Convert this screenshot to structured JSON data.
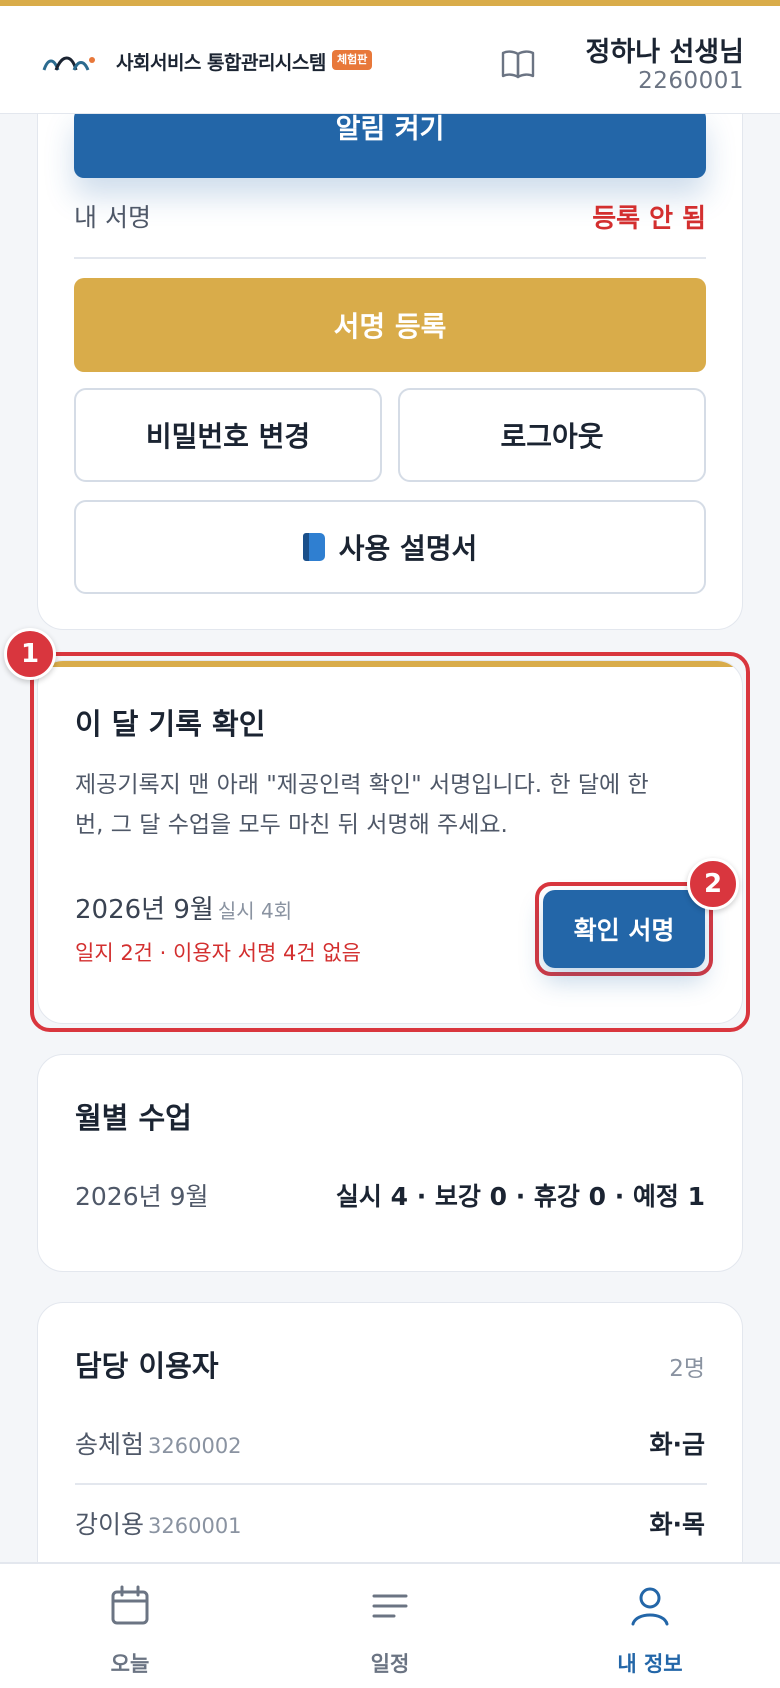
{
  "header": {
    "app_title": "사회서비스 통합관리시스템",
    "badge": "체험판",
    "user_name": "정하나 선생님",
    "user_id": "2260001"
  },
  "account": {
    "notify_button": "알림 켜기",
    "signature_label": "내 서명",
    "signature_status": "등록 안 됨",
    "register_signature_button": "서명 등록",
    "change_password_button": "비밀번호 변경",
    "logout_button": "로그아웃",
    "manual_button": "사용 설명서"
  },
  "monthly_sign": {
    "title": "이 달 기록 확인",
    "description": "제공기록지 맨 아래 \"제공인력 확인\" 서명입니다. 한 달에 한 번, 그 달 수업을 모두 마친 뒤 서명해 주세요.",
    "month": "2026년 9월",
    "count": "실시 4회",
    "warning": "일지 2건 · 이용자 서명 4건 없음",
    "confirm_button": "확인 서명"
  },
  "markers": [
    "1",
    "2"
  ],
  "monthly_classes": {
    "title": "월별 수업",
    "month": "2026년 9월",
    "summary": "실시 4 · 보강 0 · 휴강 0 · 예정 1"
  },
  "clients": {
    "title": "담당 이용자",
    "count": "2명",
    "items": [
      {
        "name": "송체험",
        "id": "3260002",
        "days": "화·금"
      },
      {
        "name": "강이용",
        "id": "3260001",
        "days": "화·목"
      }
    ]
  },
  "nav": {
    "items": [
      {
        "label": "오늘",
        "icon": "calendar-icon"
      },
      {
        "label": "일정",
        "icon": "list-icon"
      },
      {
        "label": "내 정보",
        "icon": "person-icon"
      }
    ],
    "active": "내 정보"
  },
  "colors": {
    "primary": "#2366a8",
    "gold": "#d9ac4a",
    "danger": "#d32f2f",
    "highlight": "#d9363e"
  }
}
